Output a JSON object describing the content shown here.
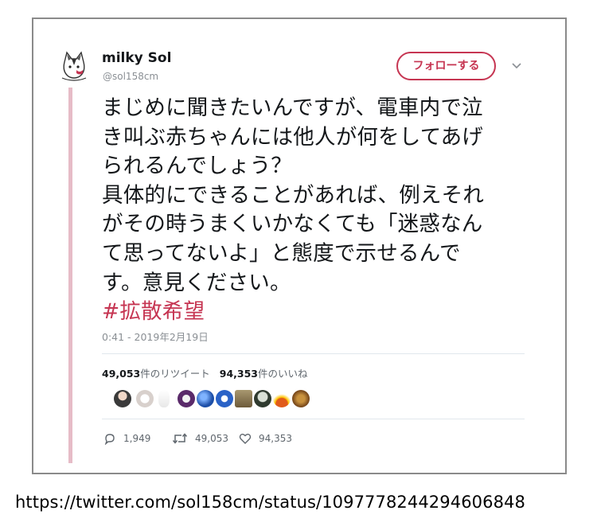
{
  "user": {
    "display_name": "milky Sol",
    "handle": "@sol158cm"
  },
  "follow_button": {
    "label": "フォローする"
  },
  "tweet": {
    "lines": [
      "まじめに聞きたいんですが、電車内で泣",
      "き叫ぶ赤ちゃんには他人が何をしてあげ",
      "られるんでしょう？",
      "具体的にできることがあれば、例えそれ",
      "がその時うまくいかなくても「迷惑なん",
      "て思ってないよ」と態度で示せるんで",
      "す。意見ください。"
    ],
    "hashtag": "#拡散希望",
    "timestamp": "0:41 - 2019年2月19日"
  },
  "stats": {
    "retweets_count": "49,053",
    "retweets_label": "件のリツイート",
    "likes_count": "94,353",
    "likes_label": "件のいいね"
  },
  "actions": {
    "reply_count": "1,949",
    "retweet_count": "49,053",
    "like_count": "94,353"
  },
  "footer_url": "https://twitter.com/sol158cm/status/1097778244294606848",
  "colors": {
    "accent": "#c63552",
    "thread_line": "#e6bcc7",
    "muted_text": "#8a8f94"
  },
  "icons": [
    "cat-avatar-icon",
    "chevron-down-icon",
    "reply-icon",
    "retweet-icon",
    "heart-icon"
  ]
}
